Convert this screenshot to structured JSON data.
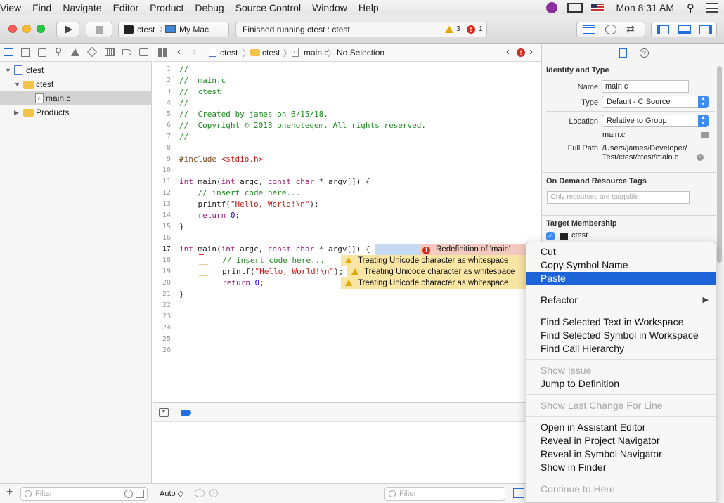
{
  "menubar": {
    "items": [
      "View",
      "Find",
      "Navigate",
      "Editor",
      "Product",
      "Debug",
      "Source Control",
      "Window",
      "Help"
    ],
    "clock": "Mon 8:31 AM"
  },
  "toolbar": {
    "scheme": "ctest",
    "destination": "My Mac",
    "status": "Finished running ctest : ctest",
    "warning_count": "3",
    "error_count": "1"
  },
  "navigator": {
    "items": [
      {
        "label": "ctest"
      },
      {
        "label": "ctest"
      },
      {
        "label": "main.c"
      },
      {
        "label": "Products"
      }
    ],
    "filter_placeholder": "Filter"
  },
  "jumpbar": {
    "crumbs": [
      "ctest",
      "ctest",
      "main.c",
      "No Selection"
    ]
  },
  "editor": {
    "line_numbers": [
      "1",
      "2",
      "3",
      "4",
      "5",
      "6",
      "7",
      "8",
      "9",
      "10",
      "11",
      "12",
      "13",
      "14",
      "15",
      "16",
      "17",
      "18",
      "19",
      "20",
      "21",
      "22",
      "23",
      "24",
      "25",
      "26"
    ],
    "issues": {
      "error": "Redefinition of 'main'",
      "warning": "Treating Unicode character as whitespace"
    }
  },
  "code": {
    "l1": "//",
    "l2": "//  main.c",
    "l3": "//  ctest",
    "l4": "//",
    "l5": "//  Created by james on 6/15/18.",
    "l6": "//  Copyright © 2018 onenotegem. All rights reserved.",
    "l7": "//",
    "inc": "#include ",
    "inc_file": "<stdio.h>",
    "kw_int": "int",
    "main_sig": " main(",
    "argc": " argc, ",
    "kw_const": "const",
    "kw_char": " char",
    "argv": " * argv[]) {",
    "c_insert": "    // insert code here...",
    "printf_a": "    printf(",
    "printf_str": "\"Hello, World!\\n\"",
    "printf_b": ");",
    "kw_return": "    return",
    "ret_val": " 0",
    "semi": ";",
    "brace": "}",
    "c_insert2": "   // insert code here...",
    "printf2": "   printf(",
    "kw_return2": "   return"
  },
  "debug": {
    "auto_label": "Auto ◇",
    "filter_placeholder": "Filter"
  },
  "inspector": {
    "identity_title": "Identity and Type",
    "name_label": "Name",
    "name_value": "main.c",
    "type_label": "Type",
    "type_value": "Default - C Source",
    "location_label": "Location",
    "location_value": "Relative to Group",
    "location_file": "main.c",
    "fullpath_label": "Full Path",
    "fullpath_line1": "/Users/james/Developer/",
    "fullpath_line2": "Test/ctest/ctest/main.c",
    "ondemand_title": "On Demand Resource Tags",
    "tags_placeholder": "Only resources are taggable",
    "target_title": "Target Membership",
    "target_name": "ctest"
  },
  "context_menu": {
    "cut": "Cut",
    "copy_symbol": "Copy Symbol Name",
    "paste": "Paste",
    "refactor": "Refactor",
    "refactor_arrow": "▶",
    "find_text": "Find Selected Text in Workspace",
    "find_symbol": "Find Selected Symbol in Workspace",
    "find_call": "Find Call Hierarchy",
    "show_issue": "Show Issue",
    "jump_def": "Jump to Definition",
    "show_last_change": "Show Last Change For Line",
    "open_assistant": "Open in Assistant Editor",
    "reveal_project": "Reveal in Project Navigator",
    "reveal_symbol": "Reveal in Symbol Navigator",
    "show_finder": "Show in Finder",
    "continue_here": "Continue to Here"
  },
  "colors": {
    "selection": "#1d64d8",
    "warning_bg": "#f9e6a4",
    "error_bg": "#f4c9c0"
  }
}
